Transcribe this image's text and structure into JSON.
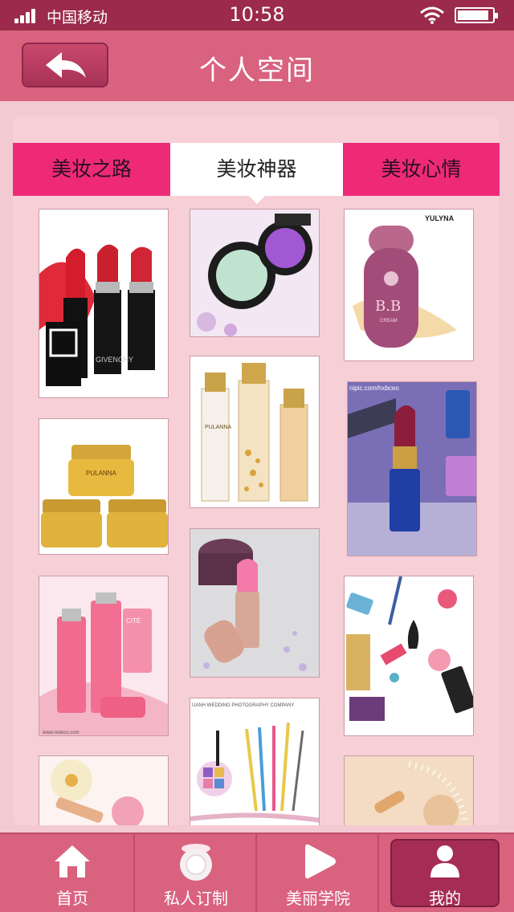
{
  "status_bar": {
    "carrier": "中国移动",
    "time": "10:58"
  },
  "header": {
    "title": "个人空间",
    "back_icon": "back-arrow-icon"
  },
  "tabs": [
    {
      "label": "美妆之路",
      "active": false
    },
    {
      "label": "美妆神器",
      "active": true
    },
    {
      "label": "美妆心情",
      "active": false
    }
  ],
  "products": {
    "lipstick_brand": "GIVENCHY",
    "bb_brand": "YULYNA",
    "bb_label": "B.B",
    "bb_sub": "CREAM",
    "cream_brand": "PULANNA",
    "serum_brand": "PULANNA",
    "citc_brand": "CITÉ",
    "nipic_watermark": "nipic.com/hxbceo",
    "wedding_caption": "UANH WEDDING PHOTOGRAPHY COMPANY",
    "redocn_watermark": "www.redocn.com"
  },
  "bottom_nav": [
    {
      "label": "首页",
      "icon": "home-icon",
      "active": false
    },
    {
      "label": "私人订制",
      "icon": "compact-powder-icon",
      "active": false
    },
    {
      "label": "美丽学院",
      "icon": "play-icon",
      "active": false
    },
    {
      "label": "我的",
      "icon": "user-icon",
      "active": true
    }
  ],
  "colors": {
    "status_bar": "#9c2a4c",
    "header": "#d9627f",
    "tab_bar": "#ee2a78",
    "panel": "#f7cfd6"
  }
}
